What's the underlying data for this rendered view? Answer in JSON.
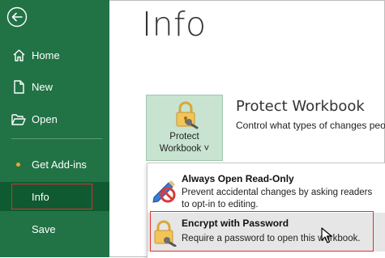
{
  "sidebar": {
    "back_label": "Back",
    "items": [
      {
        "id": "home",
        "label": "Home"
      },
      {
        "id": "new",
        "label": "New"
      },
      {
        "id": "open",
        "label": "Open"
      },
      {
        "id": "addins",
        "label": "Get Add-ins"
      },
      {
        "id": "info",
        "label": "Info"
      },
      {
        "id": "save",
        "label": "Save"
      }
    ],
    "accent_dot_color": "#f5a623",
    "bg_color": "#217346"
  },
  "main": {
    "title": "Info",
    "protect": {
      "button_line1": "Protect",
      "button_line2": "Workbook ˅",
      "section_title": "Protect Workbook",
      "section_desc": "Control what types of changes peo"
    },
    "menu": [
      {
        "title": "Always Open Read-Only",
        "desc": "Prevent accidental changes by asking readers to opt-in to editing.",
        "icon": "pencil-prohibited-icon"
      },
      {
        "title": "Encrypt with Password",
        "desc": "Require a password to open this workbook.",
        "icon": "lock-key-icon"
      }
    ]
  }
}
